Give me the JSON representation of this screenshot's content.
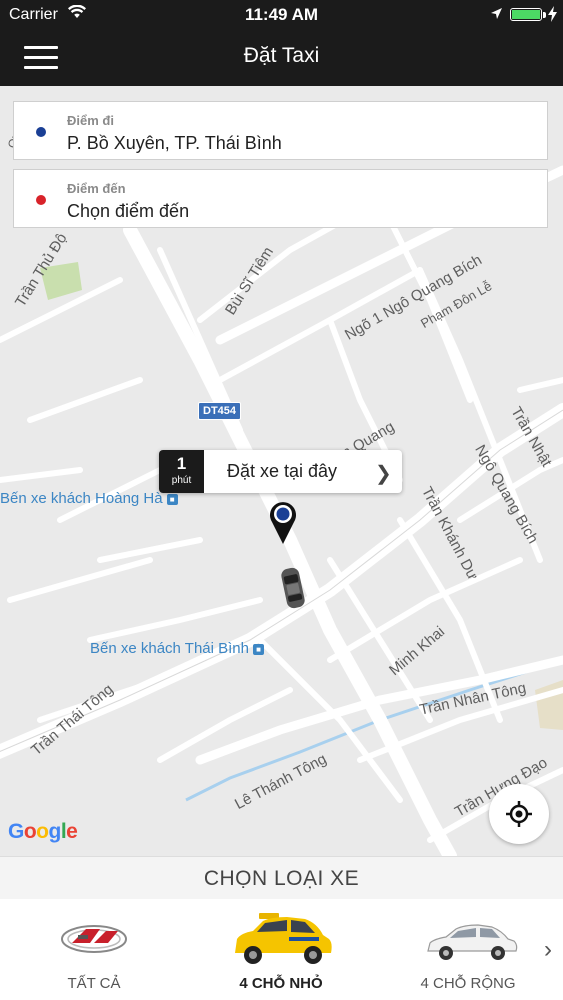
{
  "status_bar": {
    "carrier": "Carrier",
    "time": "11:49 AM",
    "battery_level": 1.0,
    "icons": [
      "wifi-icon",
      "location-arrow-icon",
      "battery-icon",
      "charging-bolt-icon"
    ]
  },
  "nav": {
    "title": "Đặt Taxi",
    "menu_icon": "hamburger-menu-icon"
  },
  "pickup": {
    "label": "Điểm đi",
    "value": "P. Bồ Xuyên, TP. Thái Bình",
    "dot_color": "#1a3f95"
  },
  "destination": {
    "label": "Điểm đến",
    "placeholder": "Chọn điểm đến",
    "dot_color": "#d8232a"
  },
  "map": {
    "street_labels": [
      "Trần Thủ Độ",
      "Bùi Sĩ Tiêm",
      "Ngõ 1 Ngô Quang Bích",
      "Phạm Đôn Lễ",
      "Trần Nhật",
      "Ngô Quang Bích",
      "Trần Khánh Dư",
      "Trần Hưng Đạo",
      "Minh Khai",
      "Trần Nhân Tông",
      "Lê Thánh Tông",
      "Trần Thái Tông",
      "Trần Quang",
      "Quang"
    ],
    "route_shield": "DT454",
    "poi": [
      "Bến xe khách Hoàng Hà",
      "Bến xe khách Thái Bình"
    ],
    "attribution": "Google",
    "colors": {
      "background": "#eaeaea",
      "road": "#ffffff",
      "park": "#c9dfae",
      "water": "#a8d0ee"
    }
  },
  "booking_bubble": {
    "eta_number": "1",
    "eta_unit": "phút",
    "label": "Đặt xe tại đây"
  },
  "vehicle_section": {
    "title": "CHỌN LOẠI XE",
    "options": [
      {
        "label": "TẤT CẢ",
        "icon": "all-vehicles-logo-icon",
        "selected": false
      },
      {
        "label": "4 CHỖ NHỎ",
        "icon": "yellow-hatchback-icon",
        "selected": true
      },
      {
        "label": "4 CHỖ RỘNG",
        "icon": "white-sedan-icon",
        "selected": false
      }
    ],
    "next_icon": "chevron-right-icon"
  }
}
